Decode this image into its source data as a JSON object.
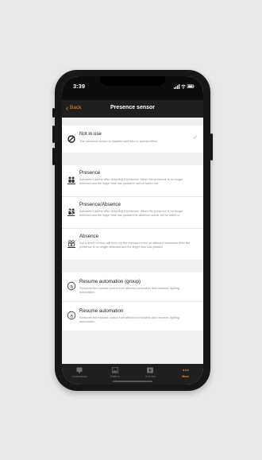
{
  "status_bar": {
    "time": "3:39"
  },
  "nav": {
    "back_label": "Back",
    "title": "Presence sensor"
  },
  "sections": [
    {
      "rows": [
        {
          "icon": "disabled-icon",
          "title": "Not in use",
          "description": "The presence sensor is disabled and has no special effect.",
          "selected": true
        }
      ]
    },
    {
      "rows": [
        {
          "icon": "people-presence-icon",
          "title": "Presence",
          "description": "Activates a scene after detecting a presence. When the presence is no longer detected and the linger time has passed it will be faded out."
        },
        {
          "icon": "people-presence-absence-icon",
          "title": "Presence/Absence",
          "description": "Activates a scene after detecting a presence. When the presence is no longer detected and the linger time has passed the absence scene will be faded in."
        },
        {
          "icon": "people-absence-icon",
          "title": "Absence",
          "description": "Not a direct control; will time out the manual control on affected luminaires after the presence is no longer detected and the linger time has passed."
        }
      ]
    },
    {
      "rows": [
        {
          "icon": "automation-icon",
          "title": "Resume automation (group)",
          "description": "Removes the manual control from affected luminaires and resumes lighting automation."
        },
        {
          "icon": "automation-icon",
          "title": "Resume automation",
          "description": "Removes the manual control from affected luminaires and resumes lighting automation."
        }
      ]
    }
  ],
  "tabs": [
    {
      "icon": "luminaire-icon",
      "label": "Luminaires"
    },
    {
      "icon": "gallery-icon",
      "label": "Gallery"
    },
    {
      "icon": "scenes-icon",
      "label": "Scenes"
    },
    {
      "icon": "more-icon",
      "label": "More",
      "active": true
    }
  ],
  "colors": {
    "accent": "#e6902a",
    "bar": "#1f1f1f",
    "background": "#f0f0f0"
  }
}
